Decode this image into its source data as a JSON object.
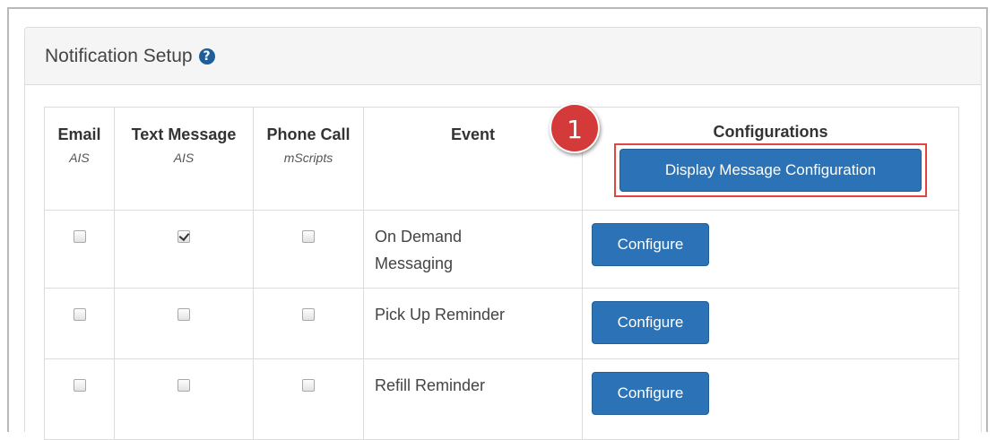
{
  "panel": {
    "title": "Notification Setup",
    "help_icon": "?"
  },
  "columns": {
    "email": {
      "label": "Email",
      "sub": "AIS"
    },
    "text": {
      "label": "Text Message",
      "sub": "AIS"
    },
    "phone": {
      "label": "Phone Call",
      "sub": "mScripts"
    },
    "event": {
      "label": "Event"
    },
    "configurations": {
      "label": "Configurations"
    }
  },
  "display_button_label": "Display Message Configuration",
  "step_badge": "1",
  "rows": [
    {
      "email": false,
      "text": true,
      "phone": false,
      "event": "On Demand Messaging",
      "button": "Configure"
    },
    {
      "email": false,
      "text": false,
      "phone": false,
      "event": "Pick Up Reminder",
      "button": "Configure"
    },
    {
      "email": false,
      "text": false,
      "phone": false,
      "event": "Refill Reminder",
      "button": "Configure"
    }
  ],
  "colors": {
    "primary_button": "#2b73b6",
    "highlight_border": "#e24444",
    "badge": "#d43a3a",
    "help_icon": "#1f5f99"
  }
}
